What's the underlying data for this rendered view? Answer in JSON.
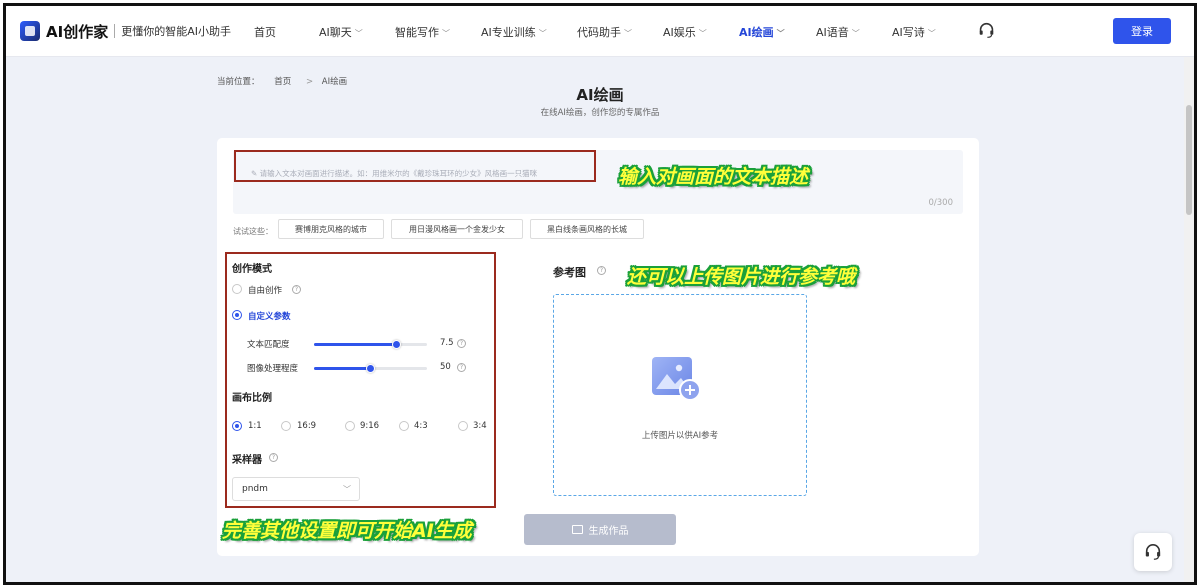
{
  "nav": {
    "logo_text": "AI创作家",
    "slogan": "更懂你的智能AI小助手",
    "items": [
      {
        "label": "首页",
        "has_chevron": false
      },
      {
        "label": "AI聊天",
        "has_chevron": true
      },
      {
        "label": "智能写作",
        "has_chevron": true
      },
      {
        "label": "AI专业训练",
        "has_chevron": true
      },
      {
        "label": "代码助手",
        "has_chevron": true
      },
      {
        "label": "AI娱乐",
        "has_chevron": true
      },
      {
        "label": "AI绘画",
        "has_chevron": true,
        "active": true
      },
      {
        "label": "AI语音",
        "has_chevron": true
      },
      {
        "label": "AI写诗",
        "has_chevron": true
      }
    ],
    "chevron_icon": "chevron-down-icon",
    "support_icon": "headset-icon",
    "login_label": "登录"
  },
  "breadcrumb": {
    "prefix": "当前位置：",
    "home": "首页",
    "separator": ">",
    "current": "AI绘画"
  },
  "page": {
    "title": "AI绘画",
    "subtitle": "在线AI绘画，创作您的专属作品"
  },
  "prompt": {
    "placeholder": "✎ 请输入文本对画面进行描述。如：用维米尔的《戴珍珠耳环的少女》风格画一只猫咪",
    "counter": "0/300"
  },
  "suggestions": {
    "label": "试试这些：",
    "chips": [
      "赛博朋克风格的城市",
      "用日漫风格画一个金发少女",
      "黑白线条画风格的长城"
    ]
  },
  "mode": {
    "title": "创作模式",
    "options": [
      {
        "label": "自由创作",
        "selected": false
      },
      {
        "label": "自定义参数",
        "selected": true
      }
    ],
    "sliders": [
      {
        "label": "文本匹配度",
        "value": "7.5",
        "fraction": 0.73
      },
      {
        "label": "图像处理程度",
        "value": "50",
        "fraction": 0.5
      }
    ]
  },
  "ratio": {
    "title": "画布比例",
    "options": [
      {
        "label": "1:1",
        "selected": true
      },
      {
        "label": "16:9",
        "selected": false
      },
      {
        "label": "9:16",
        "selected": false
      },
      {
        "label": "4:3",
        "selected": false
      },
      {
        "label": "3:4",
        "selected": false
      }
    ]
  },
  "sampler": {
    "title": "采样器",
    "value": "pndm"
  },
  "reference": {
    "title": "参考图",
    "upload_text": "上传图片以供AI参考",
    "upload_icon": "image-add-icon"
  },
  "generate_label": "生成作品",
  "annotations": {
    "prompt_hint": "输入对画面的文本描述",
    "reference_hint": "还可以上传图片进行参考哦",
    "settings_hint": "完善其他设置即可开始AI生成"
  },
  "colors": {
    "accent": "#2f54eb",
    "annotation_box": "#9b2a1e",
    "annotation_text": "#ffff3a",
    "annotation_outline": "#1aa03a"
  }
}
